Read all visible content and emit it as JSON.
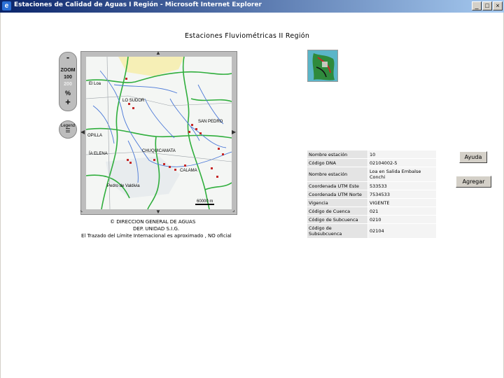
{
  "window": {
    "title": "Estaciones de Calidad de Aguas I Región - Microsoft Internet Explorer",
    "minimize": "_",
    "maximize": "□",
    "close": "×"
  },
  "page": {
    "title": "Estaciones Fluviométricas II Región"
  },
  "zoom": {
    "minus": "-",
    "label": "ZOOM",
    "level_100": "100",
    "level_200": "200",
    "percent": "%",
    "plus": "+"
  },
  "legend": {
    "label": "Legend"
  },
  "map": {
    "places": [
      "El Loa",
      "LO SUDOR",
      "SAN PEDRO",
      "OPILLA",
      "ÍA ELENA",
      "CHUQUICAMATA",
      "CALAMA",
      "Pedro de Valdivia"
    ],
    "scale_label": "60000 m"
  },
  "credits": {
    "line1": "© DIRECCION GENERAL DE AGUAS",
    "line2": "DEP. UNIDAD S.I.G.",
    "line3": "El Trazado del Límite Internacional es aproximado , NO oficial"
  },
  "station": {
    "rows": [
      {
        "label": "Nombre estación",
        "value": "10"
      },
      {
        "label": "Código DNA",
        "value": "02104002-5"
      },
      {
        "label": "Nombre estación",
        "value": "Loa en Salida Embalse Conchi"
      },
      {
        "label": "Coordenada UTM Este",
        "value": "533533"
      },
      {
        "label": "Coordenada UTM Norte",
        "value": "7534533"
      },
      {
        "label": "Vigencia",
        "value": "VIGENTE"
      },
      {
        "label": "Código de Cuenca",
        "value": "021"
      },
      {
        "label": "Código de Subcuenca",
        "value": "0210"
      },
      {
        "label": "Código de Subsubcuenca",
        "value": "02104"
      }
    ]
  },
  "buttons": {
    "ayuda": "Ayuda",
    "agregar": "Agregar"
  },
  "colors": {
    "titlebar_start": "#0a246a",
    "titlebar_end": "#a6caf0",
    "road_green": "#2fae3c",
    "river_blue": "#4a78d8",
    "station_red": "#c62828"
  }
}
